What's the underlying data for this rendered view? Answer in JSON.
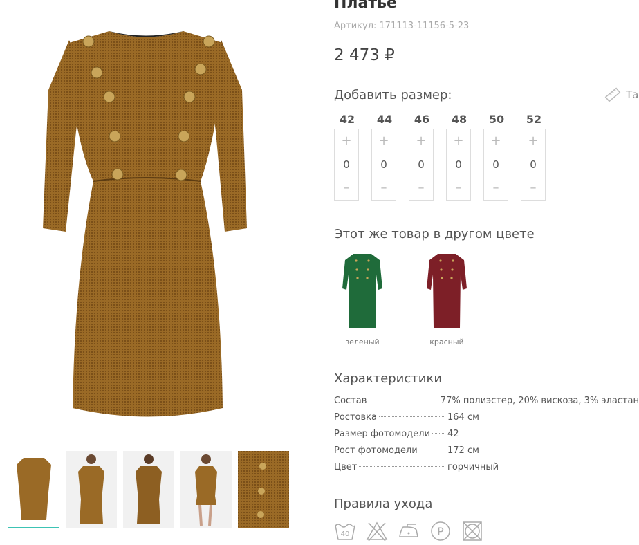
{
  "product": {
    "title": "Платье",
    "sku_label": "Артикул:",
    "sku": "171113-11156-5-23",
    "price": "2 473 ₽"
  },
  "sizes": {
    "heading": "Добавить размер:",
    "table_link": "Та",
    "plus": "+",
    "minus": "–",
    "items": [
      {
        "label": "42",
        "qty": "0"
      },
      {
        "label": "44",
        "qty": "0"
      },
      {
        "label": "46",
        "qty": "0"
      },
      {
        "label": "48",
        "qty": "0"
      },
      {
        "label": "50",
        "qty": "0"
      },
      {
        "label": "52",
        "qty": "0"
      }
    ]
  },
  "other_colors": {
    "heading": "Этот же товар в другом цвете",
    "items": [
      {
        "name": "зеленый",
        "color": "#1f6b3a"
      },
      {
        "name": "красный",
        "color": "#7d1f27"
      }
    ]
  },
  "characteristics": {
    "heading": "Характеристики",
    "rows": [
      {
        "key": "Состав",
        "value": "77% полиэстер, 20% вискоза, 3% эластан"
      },
      {
        "key": "Ростовка",
        "value": "164 см"
      },
      {
        "key": "Размер фотомодели",
        "value": "42"
      },
      {
        "key": "Рост фотомодели",
        "value": "172 см"
      },
      {
        "key": "Цвет",
        "value": "горчичный"
      }
    ]
  },
  "care": {
    "heading": "Правила ухода",
    "wash_temp": "40",
    "dryclean_letter": "P",
    "icons": [
      "wash-40-icon",
      "no-bleach-icon",
      "iron-low-icon",
      "dry-clean-p-icon",
      "no-tumble-dry-icon"
    ]
  },
  "colors": {
    "dress": "#9a6a26",
    "accent": "#3cc3b4"
  }
}
